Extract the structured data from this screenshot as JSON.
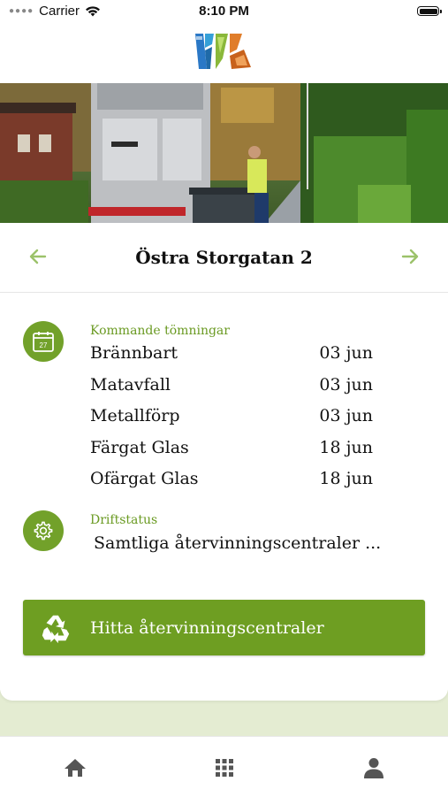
{
  "status_bar": {
    "carrier": "Carrier",
    "time": "8:10 PM"
  },
  "header": {
    "logo": "company-logo"
  },
  "address": {
    "title": "Östra Storgatan 2",
    "prev_icon": "arrow-left-icon",
    "next_icon": "arrow-right-icon"
  },
  "upcoming": {
    "label": "Kommande tömningar",
    "icon": "calendar-icon",
    "icon_day": "27",
    "items": [
      {
        "name": "Brännbart",
        "date": "03 jun"
      },
      {
        "name": "Matavfall",
        "date": "03 jun"
      },
      {
        "name": "Metallförp",
        "date": "03 jun"
      },
      {
        "name": "Färgat Glas",
        "date": "18 jun"
      },
      {
        "name": "Ofärgat Glas",
        "date": "18 jun"
      }
    ]
  },
  "operating_status": {
    "label": "Driftstatus",
    "icon": "gear-icon",
    "text": "Samtliga återvinningscentraler ..."
  },
  "find_button": {
    "label": "Hitta återvinningscentraler",
    "icon": "recycle-icon"
  },
  "tabbar": {
    "items": [
      "home-icon",
      "grid-icon",
      "profile-icon"
    ]
  },
  "colors": {
    "accent": "#72a12a",
    "label_green": "#6a9a22",
    "button_green": "#6e9e22",
    "band": "#e4ecd2"
  }
}
